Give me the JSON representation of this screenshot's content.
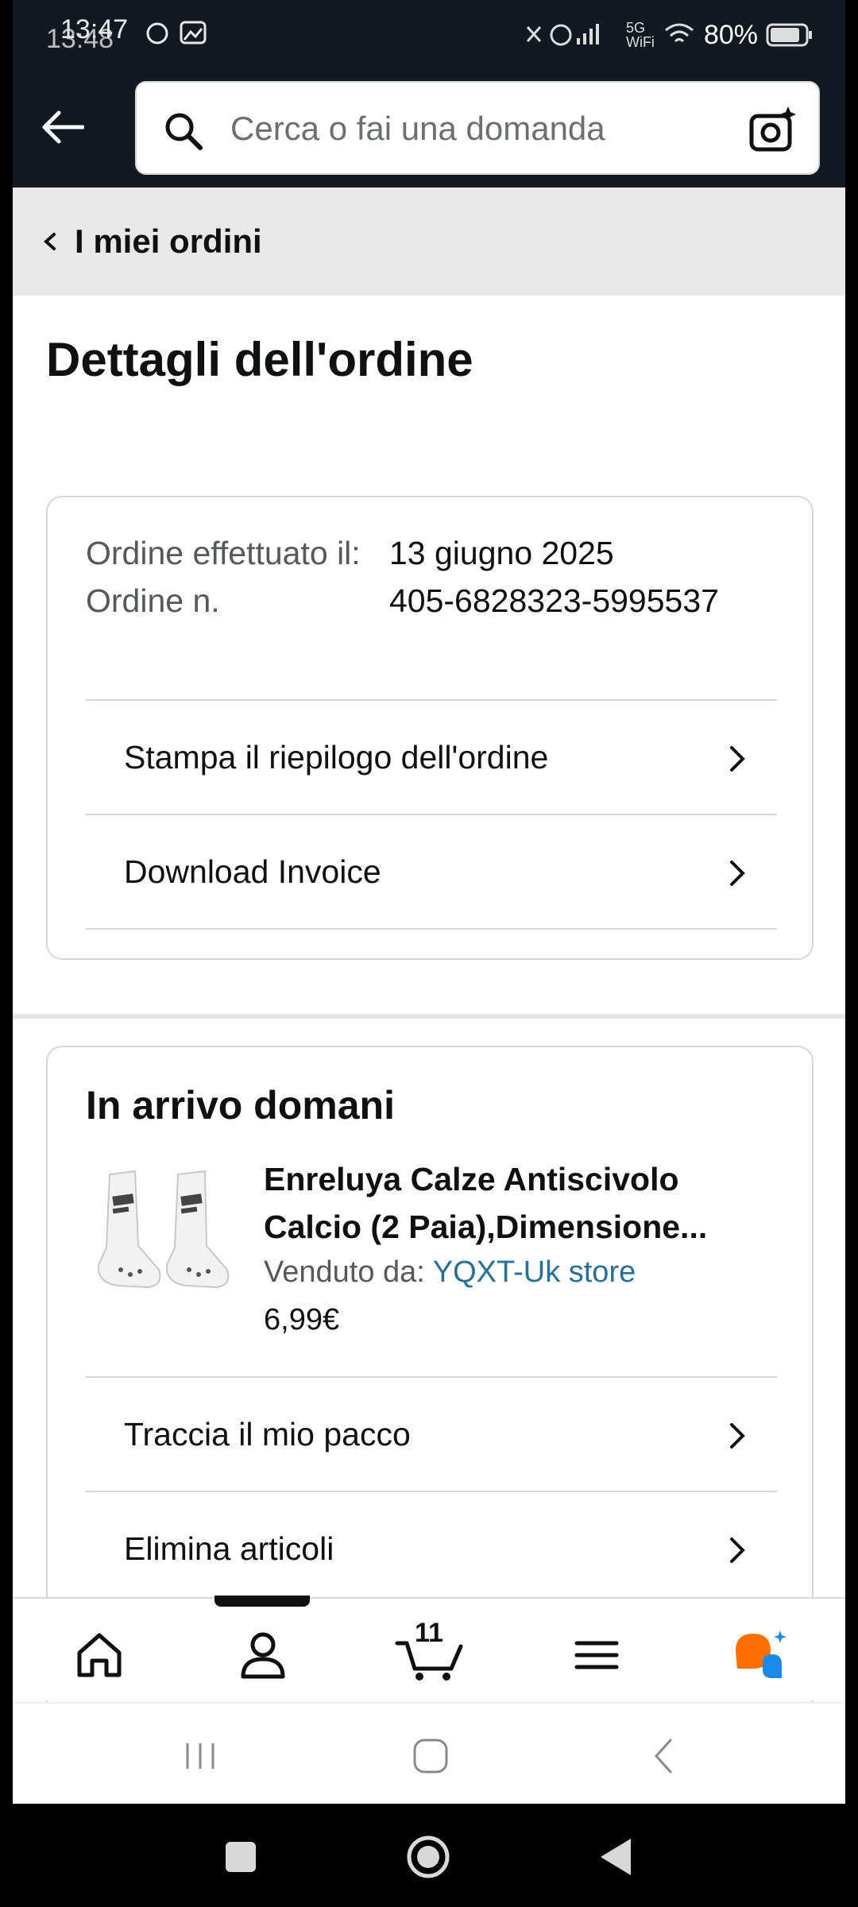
{
  "status_bar": {
    "time_primary": "13:47",
    "time_secondary": "13:48",
    "network": "5G",
    "wifi_label": "WiFi",
    "battery": "80%"
  },
  "search": {
    "placeholder": "Cerca o fai una domanda"
  },
  "breadcrumb": {
    "label": "I miei ordini"
  },
  "page": {
    "title": "Dettagli dell'ordine"
  },
  "order": {
    "placed_label": "Ordine effettuato il:",
    "number_label": "Ordine n.",
    "placed_value": "13 giugno 2025",
    "number_value": "405-6828323-5995537",
    "links": {
      "print": "Stampa il riepilogo dell'ordine",
      "invoice": "Download Invoice"
    }
  },
  "shipment": {
    "title": "In arrivo domani",
    "product_name": "Enreluya Calze Antiscivolo Calcio (2 Paia),Dimensione...",
    "seller_label": "Venduto da:",
    "seller_name": "YQXT-Uk store",
    "price": "6,99€",
    "links": {
      "track": "Traccia il mio pacco",
      "remove": "Elimina articoli"
    }
  },
  "bottom_nav": {
    "cart_count": "11",
    "items": [
      "home",
      "profile",
      "cart",
      "menu",
      "rufus"
    ],
    "active": "profile"
  },
  "colors": {
    "header_bg": "#131921",
    "link": "#2a6f97",
    "rufus_orange": "#ff6f00",
    "rufus_blue": "#1e88e5"
  }
}
